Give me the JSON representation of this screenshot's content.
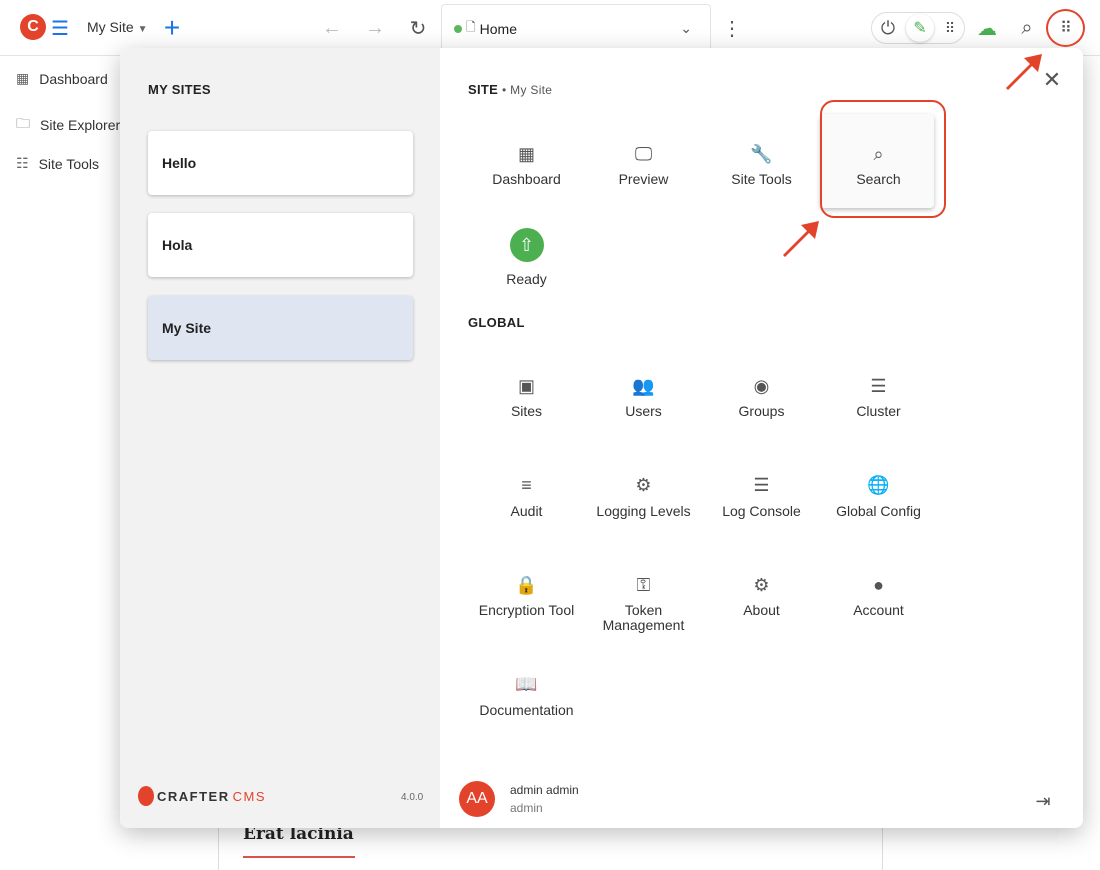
{
  "topbar": {
    "site_name": "My Site",
    "page_name": "Home",
    "brand_color": "#e2432a",
    "accent": "#1a73e8"
  },
  "nav": {
    "items": [
      {
        "label": "Dashboard",
        "icon": "dashboard-icon"
      },
      {
        "label": "Site Explorer",
        "icon": "folder-search-icon"
      },
      {
        "label": "Site Tools",
        "icon": "tune-icon"
      }
    ]
  },
  "background": {
    "heading": "Erat lacinia"
  },
  "launcher": {
    "my_sites_title": "MY SITES",
    "sites": [
      {
        "label": "Hello"
      },
      {
        "label": "Hola"
      },
      {
        "label": "My Site",
        "selected": true
      }
    ],
    "site_title": "SITE",
    "site_subtitle": "• My Site",
    "site_tiles": [
      {
        "label": "Dashboard",
        "icon": "dashboard-icon"
      },
      {
        "label": "Preview",
        "icon": "preview-icon"
      },
      {
        "label": "Site Tools",
        "icon": "wrench-icon"
      },
      {
        "label": "Search",
        "icon": "search-icon"
      },
      {
        "label": "Ready",
        "icon": "cloud-upload-icon"
      }
    ],
    "global_title": "GLOBAL",
    "global_tiles": [
      {
        "label": "Sites",
        "icon": "sites-icon"
      },
      {
        "label": "Users",
        "icon": "users-icon"
      },
      {
        "label": "Groups",
        "icon": "groups-icon"
      },
      {
        "label": "Cluster",
        "icon": "cluster-icon"
      },
      {
        "label": "Audit",
        "icon": "audit-icon"
      },
      {
        "label": "Logging Levels",
        "icon": "logging-icon"
      },
      {
        "label": "Log Console",
        "icon": "log-console-icon"
      },
      {
        "label": "Global Config",
        "icon": "globe-icon"
      },
      {
        "label": "Encryption Tool",
        "icon": "lock-icon"
      },
      {
        "label": "Token Management",
        "icon": "key-icon"
      },
      {
        "label": "About",
        "icon": "crafter-icon"
      },
      {
        "label": "Account",
        "icon": "account-icon"
      },
      {
        "label": "Documentation",
        "icon": "book-icon"
      }
    ],
    "logo_text": "CRAFTERCMS",
    "version": "4.0.0",
    "user": {
      "initials": "AA",
      "name": "admin admin",
      "username": "admin",
      "avatar_color": "#e2432a"
    }
  }
}
